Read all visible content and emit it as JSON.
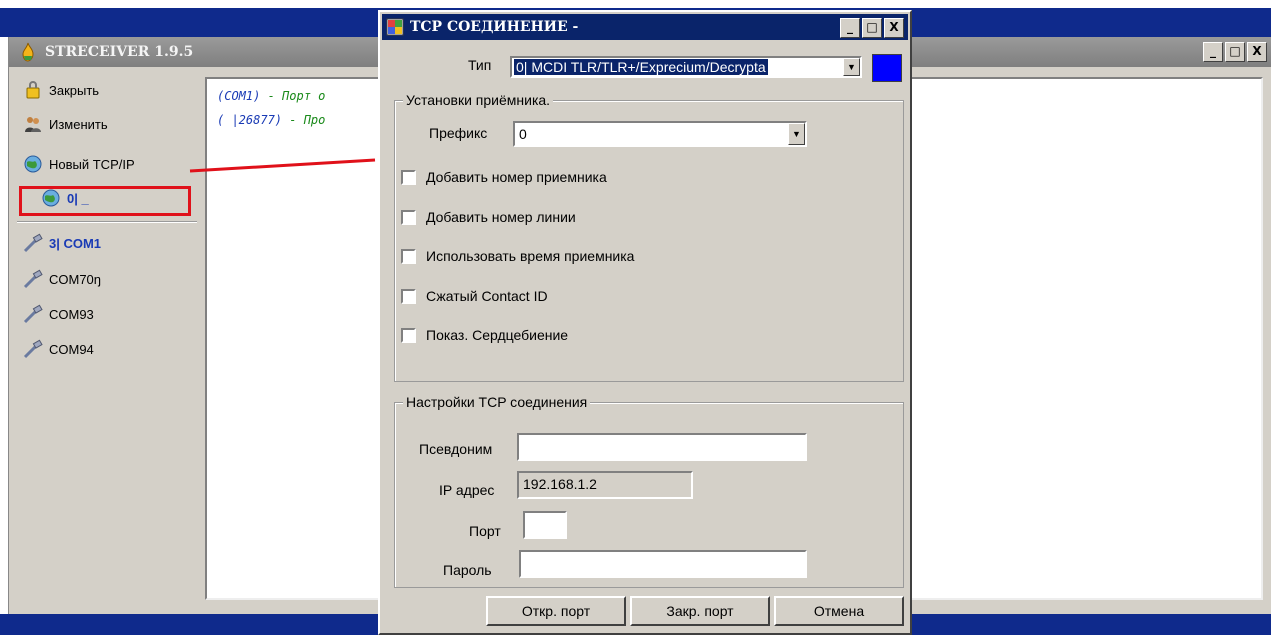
{
  "main_window": {
    "title": "STRECEIVER 1.9.5",
    "controls": {
      "minimize": "_",
      "maximize": "□",
      "close": "X"
    }
  },
  "sidebar": {
    "items": [
      {
        "label": "Закрыть",
        "icon": "lock-icon"
      },
      {
        "label": "Изменить",
        "icon": "people-icon"
      },
      {
        "label": "Новый TCP/IP",
        "icon": "globe-icon"
      },
      {
        "label": "0| _",
        "icon": "globe-icon"
      },
      {
        "label": "3| COM1",
        "icon": "serial-cable-icon"
      },
      {
        "label": "COM70ŋ",
        "icon": "serial-cable-icon"
      },
      {
        "label": "COM93",
        "icon": "serial-cable-icon"
      },
      {
        "label": "COM94",
        "icon": "serial-cable-icon"
      }
    ]
  },
  "log": {
    "lines": [
      {
        "port": "(COM1)",
        "desc": " - Порт о"
      },
      {
        "port": "( |26877)",
        "desc": " - Про"
      }
    ]
  },
  "dialog": {
    "title": "TCP СОЕДИНЕНИЕ -",
    "controls": {
      "minimize": "_",
      "maximize": "□",
      "close": "X"
    },
    "type_label": "Тип",
    "type_value": "0| MCDI TLR/TLR+/Exprecium/Decrypta",
    "color_swatch": "#0000ff",
    "receiver_group": {
      "title": "Установки приёмника.",
      "prefix_label": "Префикс",
      "prefix_value": "0",
      "checkboxes": [
        {
          "label": "Добавить номер  приемника",
          "checked": false
        },
        {
          "label": "Добавить номер линии",
          "checked": false
        },
        {
          "label": "Использовать время приемника",
          "checked": false
        },
        {
          "label": "Сжатый Contact ID",
          "checked": false
        },
        {
          "label": "Показ. Сердцебиение",
          "checked": false
        }
      ]
    },
    "tcp_group": {
      "title": "Настройки TCP соединения",
      "alias_label": "Псевдоним",
      "alias_value": "",
      "ip_label": "IP адрес",
      "ip_value": "192.168.1.2",
      "port_label": "Порт",
      "port_value": "",
      "password_label": "Пароль",
      "password_value": ""
    },
    "buttons": {
      "open_port": "Откр. порт",
      "close_port": "Закр. порт",
      "cancel": "Отмена"
    }
  },
  "colors": {
    "dialog_title_bg": "#0a246a",
    "highlight_red": "#e0111a",
    "log_port": "#1a3bb5",
    "log_desc": "#1a8a1a"
  }
}
